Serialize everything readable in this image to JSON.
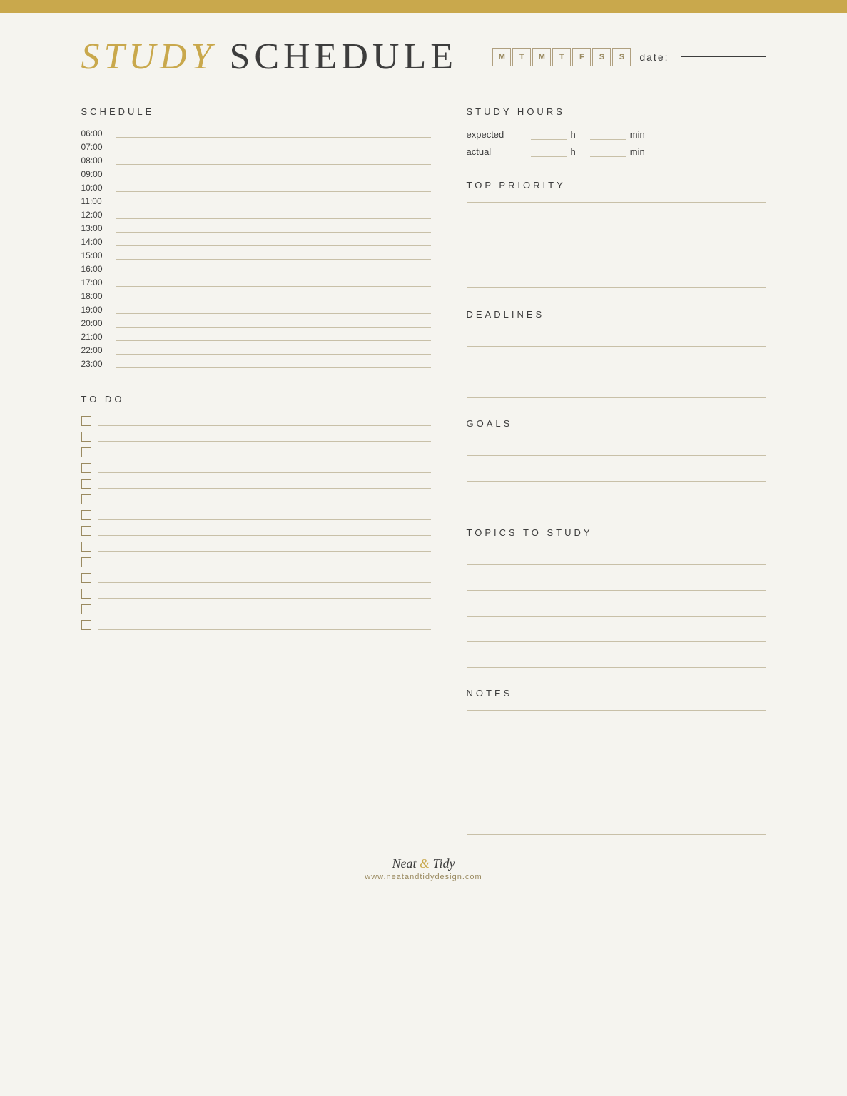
{
  "gold_bar": true,
  "header": {
    "title_study": "STUDY",
    "title_schedule": "SCHEDULE",
    "day_boxes": [
      "M",
      "T",
      "M",
      "T",
      "F",
      "S",
      "S"
    ],
    "date_label": "date:"
  },
  "schedule": {
    "heading": "SCHEDULE",
    "times": [
      "06:00",
      "07:00",
      "08:00",
      "09:00",
      "10:00",
      "11:00",
      "12:00",
      "13:00",
      "14:00",
      "15:00",
      "16:00",
      "17:00",
      "18:00",
      "19:00",
      "20:00",
      "21:00",
      "22:00",
      "23:00"
    ]
  },
  "todo": {
    "heading": "TO DO",
    "items": 14
  },
  "study_hours": {
    "heading": "STUDY HOURS",
    "expected_label": "expected",
    "actual_label": "actual",
    "h_unit": "h",
    "min_unit": "min"
  },
  "top_priority": {
    "heading": "TOP PRIORITY"
  },
  "deadlines": {
    "heading": "DEADLINES",
    "lines": 3
  },
  "goals": {
    "heading": "GOALS",
    "lines": 3
  },
  "topics": {
    "heading": "TOPICS TO STUDY",
    "lines": 5
  },
  "notes": {
    "heading": "NOTES"
  },
  "footer": {
    "brand_part1": "Neat ",
    "ampersand": "&",
    "brand_part2": " Tidy",
    "url": "www.neatandtidydesign.com"
  }
}
